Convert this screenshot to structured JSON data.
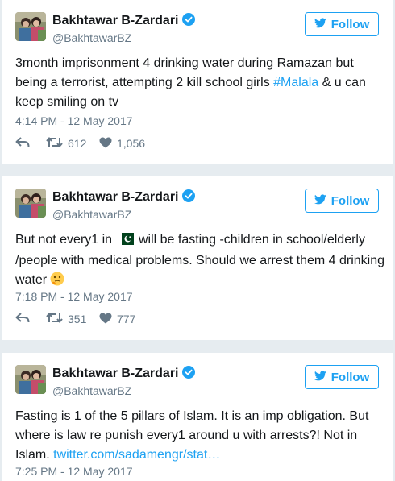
{
  "tweets": [
    {
      "name": "Bakhtawar B-Zardari",
      "handle": "@BakhtawarBZ",
      "follow_label": "Follow",
      "text_parts": [
        "3month imprisonment 4 drinking water during Ramazan but being a terrorist, attempting 2 kill school girls ",
        "#Malala",
        " & u can keep smiling on tv"
      ],
      "time": "4:14 PM - 12 May 2017",
      "retweets": "612",
      "likes": "1,056"
    },
    {
      "name": "Bakhtawar B-Zardari",
      "handle": "@BakhtawarBZ",
      "follow_label": "Follow",
      "text_parts": [
        "But not every1 in ",
        " will be fasting -children in school/elderly /people with medical problems. Should we arrest them 4 drinking water"
      ],
      "time": "7:18 PM - 12 May 2017",
      "retweets": "351",
      "likes": "777"
    },
    {
      "name": "Bakhtawar B-Zardari",
      "handle": "@BakhtawarBZ",
      "follow_label": "Follow",
      "text_parts": [
        "Fasting is 1 of the 5 pillars of Islam. It is an imp obligation. But where is law re punish every1 around u with arrests?! Not in Islam. ",
        "twitter.com/sadamengr/stat…"
      ],
      "time": "7:25 PM - 12 May 2017"
    }
  ],
  "colors": {
    "accent": "#1da1f2",
    "muted": "#657786",
    "text": "#14171a",
    "background": "#e6ecf0"
  },
  "icons": [
    "verified-badge-icon",
    "twitter-bird-icon",
    "reply-icon",
    "retweet-icon",
    "heart-icon",
    "pakistan-flag-icon",
    "thinking-face-icon"
  ]
}
